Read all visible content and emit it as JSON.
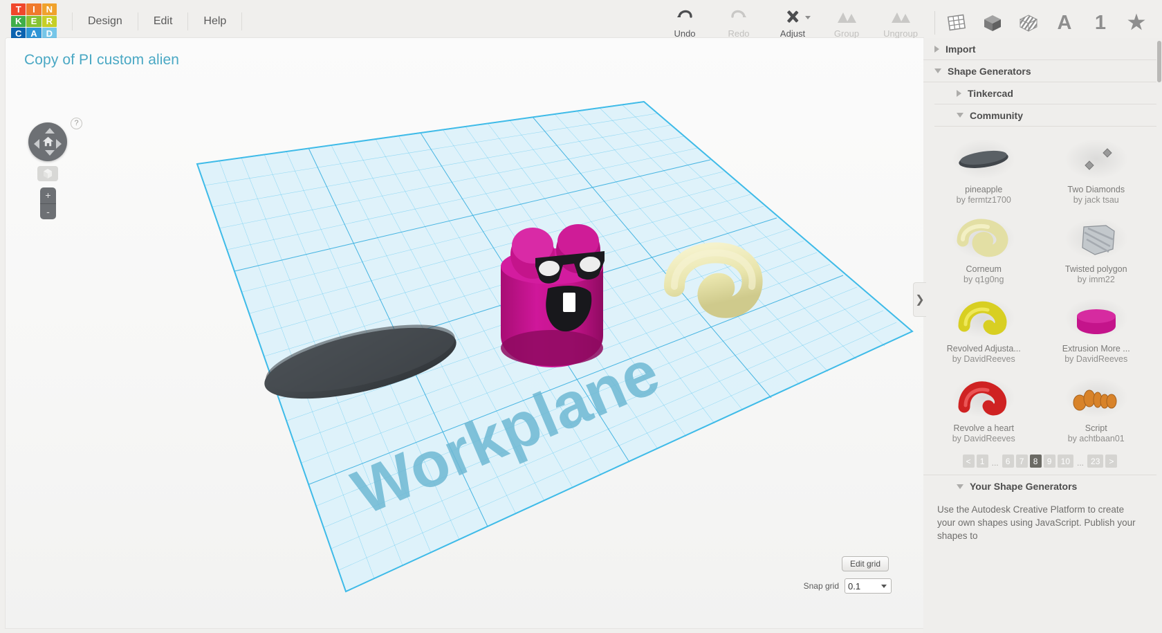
{
  "app": {
    "logo_letters": [
      {
        "ch": "T",
        "color": "#f0472c"
      },
      {
        "ch": "I",
        "color": "#f07a2c"
      },
      {
        "ch": "N",
        "color": "#f0a22c"
      },
      {
        "ch": "K",
        "color": "#3fae4a"
      },
      {
        "ch": "E",
        "color": "#86c232"
      },
      {
        "ch": "R",
        "color": "#c6cf26"
      },
      {
        "ch": "C",
        "color": "#0b63b0"
      },
      {
        "ch": "A",
        "color": "#2e95d6"
      },
      {
        "ch": "D",
        "color": "#76c6e8"
      }
    ]
  },
  "menu": {
    "items": [
      {
        "label": "Design"
      },
      {
        "label": "Edit"
      },
      {
        "label": "Help"
      }
    ]
  },
  "toolbar": {
    "tools": [
      {
        "label": "Undo",
        "icon": "undo-icon",
        "disabled": false,
        "caret": false
      },
      {
        "label": "Redo",
        "icon": "redo-icon",
        "disabled": true,
        "caret": false
      },
      {
        "label": "Adjust",
        "icon": "adjust-icon",
        "disabled": false,
        "caret": true
      },
      {
        "label": "Group",
        "icon": "group-icon",
        "disabled": true,
        "caret": false
      },
      {
        "label": "Ungroup",
        "icon": "ungroup-icon",
        "disabled": true,
        "caret": false
      }
    ],
    "right_icons": [
      {
        "name": "workplane-icon",
        "glyph": ""
      },
      {
        "name": "solid-cube-icon",
        "glyph": ""
      },
      {
        "name": "hole-cube-icon",
        "glyph": ""
      },
      {
        "name": "text-icon",
        "glyph": "A"
      },
      {
        "name": "number-icon",
        "glyph": "1"
      },
      {
        "name": "favorites-icon",
        "glyph": "★"
      }
    ]
  },
  "workspace": {
    "document_title": "Copy of PI custom alien",
    "workplane_label": "Workplane",
    "help_badge": "?",
    "zoom_in": "+",
    "zoom_out": "-",
    "edit_grid_label": "Edit grid",
    "snap_grid_label": "Snap grid",
    "snap_grid_value": "0.1",
    "accent_color": "#4aa8c4",
    "grid_color": "#29b6e8",
    "objects": [
      {
        "name": "dark-ellipse-disc",
        "color": "#3d4145"
      },
      {
        "name": "magenta-alien-body",
        "color": "#c4148b"
      },
      {
        "name": "cream-corneum-shape",
        "color": "#e8e5b0"
      }
    ]
  },
  "panel": {
    "sections": [
      {
        "label": "Import",
        "state": "collapsed",
        "level": 1
      },
      {
        "label": "Shape Generators",
        "state": "expanded",
        "level": 1
      },
      {
        "label": "Tinkercad",
        "state": "collapsed",
        "level": 2
      },
      {
        "label": "Community",
        "state": "expanded",
        "level": 2
      }
    ],
    "shapes": [
      {
        "name": "pineapple",
        "author": "by fermtz1700",
        "icon": "disc-shape",
        "color": "#41464b"
      },
      {
        "name": "Two Diamonds",
        "author": "by jack tsau",
        "icon": "diamonds-shape",
        "color": "#9b9b9b"
      },
      {
        "name": "Corneum",
        "author": "by q1g0ng",
        "icon": "corneum-shape",
        "color": "#e3dfa4"
      },
      {
        "name": "Twisted polygon",
        "author": "by imm22",
        "icon": "twisted-polygon-shape",
        "color": "#b7bcc0"
      },
      {
        "name": "Revolved Adjusta...",
        "author": "by DavidReeves",
        "icon": "revolved-shape",
        "color": "#d8cf22"
      },
      {
        "name": "Extrusion More ...",
        "author": "by DavidReeves",
        "icon": "extrusion-shape",
        "color": "#c4148b"
      },
      {
        "name": "Revolve a heart",
        "author": "by DavidReeves",
        "icon": "heart-revolve-shape",
        "color": "#cf2222"
      },
      {
        "name": "Script",
        "author": "by achtbaan01",
        "icon": "script-shape",
        "color": "#d8832a"
      }
    ],
    "pagination": [
      {
        "label": "<",
        "active": false,
        "type": "prev"
      },
      {
        "label": "1",
        "active": false,
        "type": "page"
      },
      {
        "label": "...",
        "active": false,
        "type": "ellipsis"
      },
      {
        "label": "6",
        "active": false,
        "type": "page"
      },
      {
        "label": "7",
        "active": false,
        "type": "page"
      },
      {
        "label": "8",
        "active": true,
        "type": "page"
      },
      {
        "label": "9",
        "active": false,
        "type": "page"
      },
      {
        "label": "10",
        "active": false,
        "type": "page"
      },
      {
        "label": "...",
        "active": false,
        "type": "ellipsis"
      },
      {
        "label": "23",
        "active": false,
        "type": "page"
      },
      {
        "label": ">",
        "active": false,
        "type": "next"
      }
    ],
    "your_shape_generators": {
      "label": "Your Shape Generators",
      "state": "expanded",
      "body": "Use the Autodesk Creative Platform to create your own shapes using JavaScript. Publish your shapes to"
    },
    "collapse_handle": "❯"
  }
}
